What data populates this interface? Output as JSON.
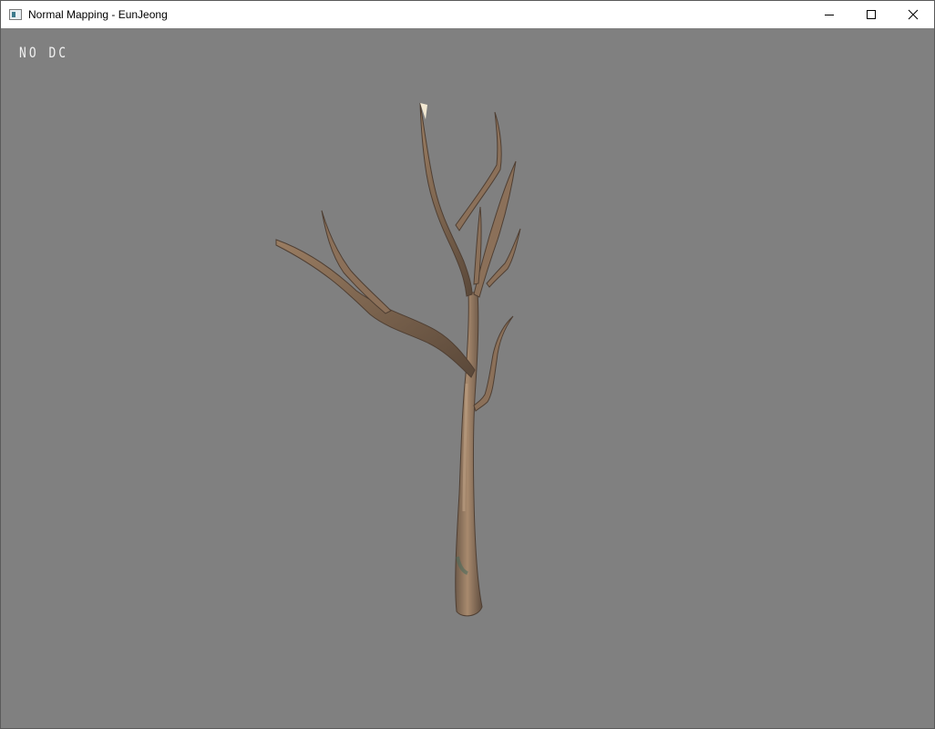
{
  "window": {
    "title": "Normal Mapping - EunJeong",
    "app_icon": "window-app-icon",
    "controls": {
      "minimize_icon": "minimize-icon",
      "maximize_icon": "maximize-icon",
      "close_icon": "close-icon"
    }
  },
  "viewport": {
    "overlay_text": "NO DC",
    "background_color": "#808080",
    "model": "tree-model"
  },
  "colors": {
    "titlebar": "#ffffff",
    "bark_light": "#a5866b",
    "bark_dark": "#5d4a3c",
    "overlay_text": "#f0f0f0"
  }
}
